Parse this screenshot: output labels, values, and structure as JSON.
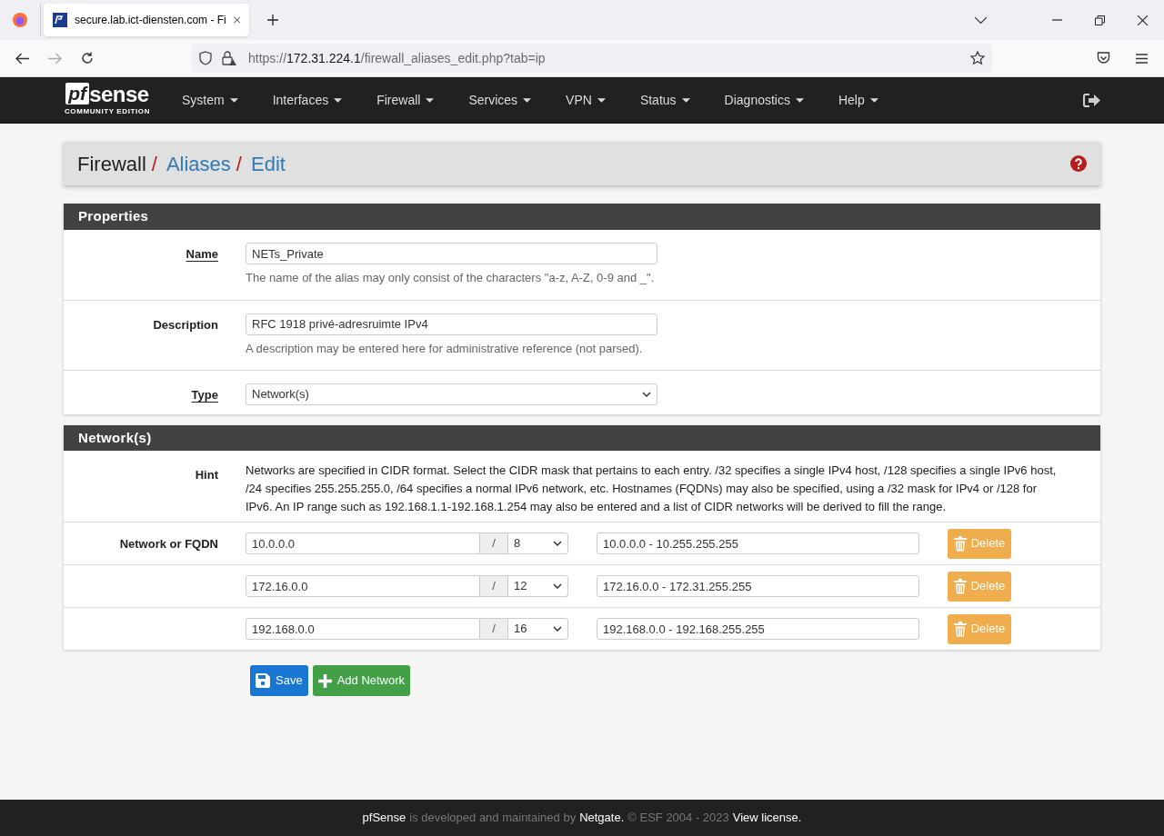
{
  "browser": {
    "tab_title": "secure.lab.ict-diensten.com - Fi",
    "url_scheme": "https://",
    "url_host": "172.31.224.1",
    "url_path": "/firewall_aliases_edit.php?tab=ip"
  },
  "logo": {
    "mark": "pf",
    "word": "sense",
    "edition": "COMMUNITY EDITION"
  },
  "nav": [
    "System",
    "Interfaces",
    "Firewall",
    "Services",
    "VPN",
    "Status",
    "Diagnostics",
    "Help"
  ],
  "breadcrumb": [
    {
      "text": "Firewall",
      "link": false
    },
    {
      "separator": "/",
      "text": "Aliases",
      "link": true
    },
    {
      "separator": "/",
      "text": "Edit",
      "link": true
    }
  ],
  "properties": {
    "title": "Properties",
    "fields": [
      {
        "kind": "input",
        "label": "Name",
        "underlined": true,
        "value": "NETs_Private",
        "help": "The name of the alias may only consist of the characters \"a-z, A-Z, 0-9 and _\"."
      },
      {
        "kind": "input",
        "label": "Description",
        "underlined": false,
        "value": "RFC 1918 privé-adresruimte IPv4",
        "help": "A description may be entered here for administrative reference (not parsed)."
      },
      {
        "kind": "select",
        "label": "Type",
        "underlined": true,
        "value": "Network(s)"
      }
    ]
  },
  "networks": {
    "title": "Network(s)",
    "hint_label": "Hint",
    "hint": "Networks are specified in CIDR format. Select the CIDR mask that pertains to each entry. /32 specifies a single IPv4 host, /128 specifies a single IPv6 host, /24 specifies 255.255.255.0, /64 specifies a normal IPv6 network, etc. Hostnames (FQDNs) may also be specified, using a /32 mask for IPv4 or /128 for IPv6. An IP range such as 192.168.1.1-192.168.1.254 may also be entered and a list of CIDR networks will be derived to fill the range.",
    "row_label": "Network or FQDN",
    "rows": [
      {
        "address": "10.0.0.0",
        "slash": "/",
        "mask": "8",
        "range": "10.0.0.0 - 10.255.255.255",
        "delete": "Delete"
      },
      {
        "address": "172.16.0.0",
        "slash": "/",
        "mask": "12",
        "range": "172.16.0.0 - 172.31.255.255",
        "delete": "Delete"
      },
      {
        "address": "192.168.0.0",
        "slash": "/",
        "mask": "16",
        "range": "192.168.0.0 - 192.168.255.255",
        "delete": "Delete"
      }
    ]
  },
  "buttons": [
    {
      "kind": "save",
      "label": "Save"
    },
    {
      "kind": "add",
      "label": "Add Network"
    }
  ],
  "footer": [
    {
      "text": "pfSense",
      "link": true
    },
    {
      "text": "is developed and maintained by",
      "link": false
    },
    {
      "text": "Netgate.",
      "link": true
    },
    {
      "text": "© ESF 2004 - 2023",
      "link": false
    },
    {
      "text": "View license.",
      "link": true
    }
  ]
}
